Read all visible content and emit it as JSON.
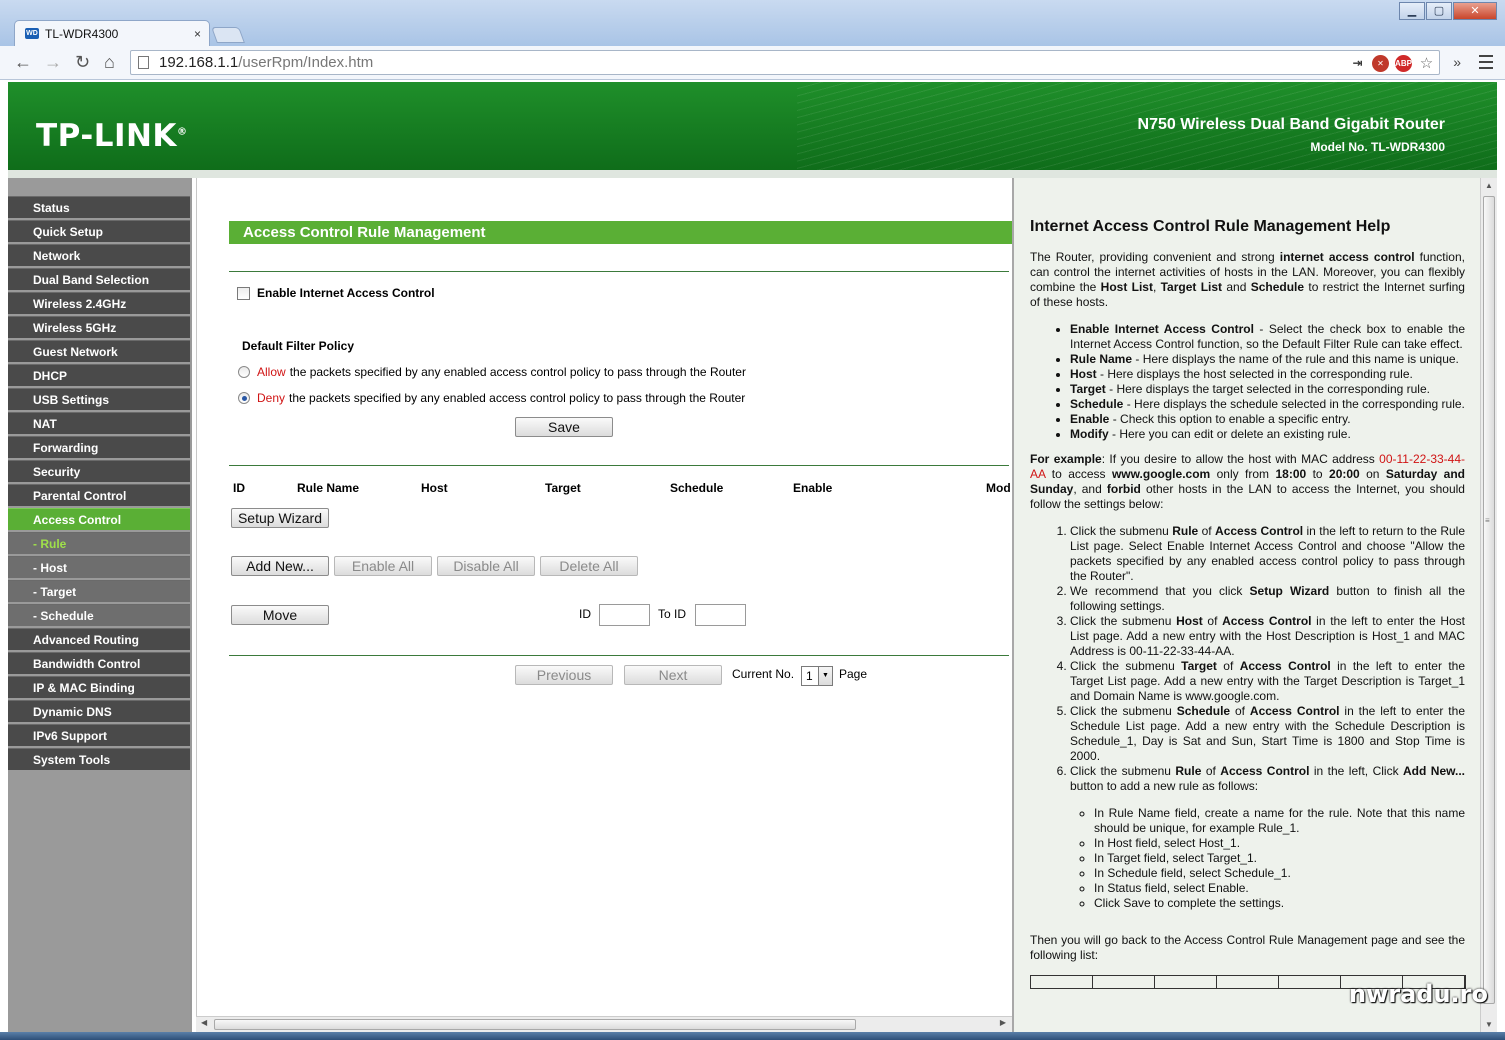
{
  "browser": {
    "tab_title": "TL-WDR4300",
    "tab_close": "×",
    "url_host": "192.168.1.1",
    "url_path": "/userRpm/Index.htm",
    "window_controls": [
      "▁",
      "▢",
      "✕"
    ],
    "nav": {
      "back": "←",
      "forward": "→",
      "reload": "↻",
      "home": "⌂",
      "more": "»"
    }
  },
  "header": {
    "logo": "TP-LINK",
    "logo_mark": "®",
    "product": "N750 Wireless Dual Band Gigabit Router",
    "model": "Model No. TL-WDR4300",
    "brand_color": "#1f8f2a"
  },
  "menu": [
    {
      "label": "Status"
    },
    {
      "label": "Quick Setup"
    },
    {
      "label": "Network"
    },
    {
      "label": "Dual Band Selection"
    },
    {
      "label": "Wireless 2.4GHz"
    },
    {
      "label": "Wireless 5GHz"
    },
    {
      "label": "Guest Network"
    },
    {
      "label": "DHCP"
    },
    {
      "label": "USB Settings"
    },
    {
      "label": "NAT"
    },
    {
      "label": "Forwarding"
    },
    {
      "label": "Security"
    },
    {
      "label": "Parental Control"
    },
    {
      "label": "Access Control"
    },
    {
      "label": "- Rule"
    },
    {
      "label": "- Host"
    },
    {
      "label": "- Target"
    },
    {
      "label": "- Schedule"
    },
    {
      "label": "Advanced Routing"
    },
    {
      "label": "Bandwidth Control"
    },
    {
      "label": "IP & MAC Binding"
    },
    {
      "label": "Dynamic DNS"
    },
    {
      "label": "IPv6 Support"
    },
    {
      "label": "System Tools"
    }
  ],
  "main": {
    "title": "Access Control Rule Management",
    "enable_label": "Enable Internet Access Control",
    "policy_title": "Default Filter Policy",
    "allow_word": "Allow",
    "allow_text": "the packets specified by any enabled access control policy to pass through the Router",
    "deny_word": "Deny",
    "deny_text": "the packets specified by any enabled access control policy to pass through the Router",
    "save": "Save",
    "columns": [
      "ID",
      "Rule Name",
      "Host",
      "Target",
      "Schedule",
      "Enable",
      "Mod"
    ],
    "setup_wizard": "Setup Wizard",
    "add_new": "Add New...",
    "enable_all": "Enable All",
    "disable_all": "Disable All",
    "delete_all": "Delete All",
    "move": "Move",
    "id_label": "ID",
    "to_id_label": "To ID",
    "previous": "Previous",
    "next": "Next",
    "current_no_label": "Current No.",
    "current_no_value": "1",
    "page_label": "Page"
  },
  "help": {
    "title": "Internet Access Control Rule Management Help",
    "intro_1": "The Router, providing convenient and strong ",
    "intro_b1": "internet access control",
    "intro_2": " function, can control the internet activities of hosts in the LAN. Moreover, you can flexibly combine the ",
    "intro_b2": "Host List",
    "intro_3": ", ",
    "intro_b3": "Target List",
    "intro_4": " and ",
    "intro_b4": "Schedule",
    "intro_5": " to restrict the Internet surfing of these hosts.",
    "bullets": [
      {
        "b": "Enable Internet Access Control",
        "t": " - Select the check box to enable the Internet Access Control function, so the Default Filter Rule can take effect."
      },
      {
        "b": "Rule Name",
        "t": " - Here displays the name of the rule and this name is unique."
      },
      {
        "b": "Host",
        "t": " - Here displays the host selected in the corresponding rule."
      },
      {
        "b": "Target",
        "t": " - Here displays the target selected in the corresponding rule."
      },
      {
        "b": "Schedule",
        "t": " - Here displays the schedule selected in the corresponding rule."
      },
      {
        "b": "Enable",
        "t": " - Check this option to enable a specific entry."
      },
      {
        "b": "Modify",
        "t": " - Here you can edit or delete an existing rule."
      }
    ],
    "example_b": "For example",
    "example_1": ": If you desire to allow the host with MAC address ",
    "example_mac": "00-11-22-33-44-AA",
    "example_2": " to access ",
    "example_site": "www.google.com",
    "example_3": " only from ",
    "example_t1": "18:00",
    "example_4": " to ",
    "example_t2": "20:00",
    "example_5": " on ",
    "example_d1": "Saturday and Sunday",
    "example_6": ", and ",
    "example_forbid": "forbid",
    "example_7": " other hosts in the LAN to access the Internet, you should follow the settings below:",
    "steps": [
      "Click the submenu <b>Rule</b> of <b>Access Control</b> in the left to return to the Rule List page. Select Enable Internet Access Control and choose \"Allow the packets specified by any enabled access control policy to pass through the Router\".",
      "We recommend that you click <b>Setup Wizard</b> button to finish all the following settings.",
      "Click the submenu <b>Host</b> of <b>Access Control</b> in the left to enter the Host List page. Add a new entry with the Host Description is Host_1 and MAC Address is 00-11-22-33-44-AA.",
      "Click the submenu <b>Target</b> of <b>Access Control</b> in the left to enter the Target List page. Add a new entry with the Target Description is Target_1 and Domain Name is www.google.com.",
      "Click the submenu <b>Schedule</b> of <b>Access Control</b> in the left to enter the Schedule List page. Add a new entry with the Schedule Description is Schedule_1, Day is Sat and Sun, Start Time is 1800 and Stop Time is 2000.",
      "Click the submenu <b>Rule</b> of <b>Access Control</b> in the left, Click <b>Add New...</b> button to add a new rule as follows:"
    ],
    "sub_steps": [
      "In Rule Name field, create a name for the rule. Note that this name should be unique, for example Rule_1.",
      "In Host field, select Host_1.",
      "In Target field, select Target_1.",
      "In Schedule field, select Schedule_1.",
      "In Status field, select Enable.",
      "Click Save to complete the settings."
    ],
    "outro": "Then you will go back to the Access Control Rule Management page and see the following list:"
  },
  "watermark": "nwradu.ro"
}
